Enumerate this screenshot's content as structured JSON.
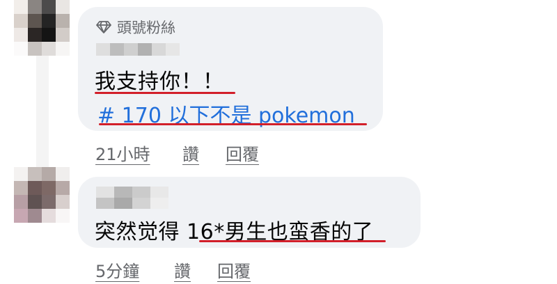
{
  "comments": [
    {
      "badge": "頭號粉絲",
      "badge_icon": "diamond-icon",
      "text": "我支持你！！",
      "hashtag": "# 170 以下不是 pokemon",
      "time": "21小時",
      "like": "讚",
      "reply": "回覆"
    },
    {
      "text": "突然觉得 16*男生也蛮香的了",
      "time": "5分鐘",
      "like": "讚",
      "reply": "回覆"
    }
  ],
  "colors": {
    "bubble": "#f0f2f5",
    "hashtag": "#216fdb",
    "annotation": "#d21f2a",
    "meta": "#65676b"
  }
}
